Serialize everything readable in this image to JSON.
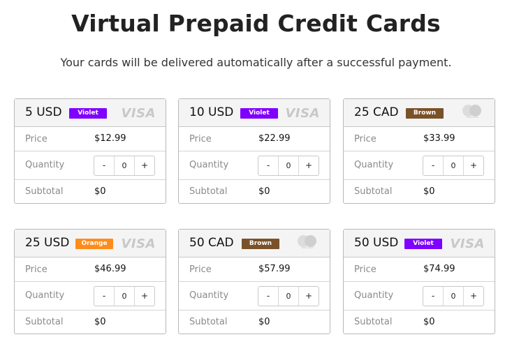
{
  "page": {
    "title": "Virtual Prepaid Credit Cards",
    "subtitle": "Your cards will be delivered automatically after a successful payment."
  },
  "labels": {
    "price": "Price",
    "quantity": "Quantity",
    "subtotal": "Subtotal",
    "minus": "-",
    "plus": "+"
  },
  "colors": {
    "violet": "#7f00ff",
    "brown": "#7a5229",
    "orange": "#ff8c1a"
  },
  "cards": [
    {
      "name": "5 USD",
      "badge": "Violet",
      "badge_color": "#7f00ff",
      "network": "visa",
      "network_label": "VISA",
      "price": "$12.99",
      "quantity": "0",
      "subtotal": "$0"
    },
    {
      "name": "10 USD",
      "badge": "Violet",
      "badge_color": "#7f00ff",
      "network": "visa",
      "network_label": "VISA",
      "price": "$22.99",
      "quantity": "0",
      "subtotal": "$0"
    },
    {
      "name": "25 CAD",
      "badge": "Brown",
      "badge_color": "#7a5229",
      "network": "mastercard",
      "network_label": "mastercard",
      "price": "$33.99",
      "quantity": "0",
      "subtotal": "$0"
    },
    {
      "name": "25 USD",
      "badge": "Orange",
      "badge_color": "#ff8c1a",
      "network": "visa",
      "network_label": "VISA",
      "price": "$46.99",
      "quantity": "0",
      "subtotal": "$0"
    },
    {
      "name": "50 CAD",
      "badge": "Brown",
      "badge_color": "#7a5229",
      "network": "mastercard",
      "network_label": "mastercard",
      "price": "$57.99",
      "quantity": "0",
      "subtotal": "$0"
    },
    {
      "name": "50 USD",
      "badge": "Violet",
      "badge_color": "#7f00ff",
      "network": "visa",
      "network_label": "VISA",
      "price": "$74.99",
      "quantity": "0",
      "subtotal": "$0"
    }
  ]
}
